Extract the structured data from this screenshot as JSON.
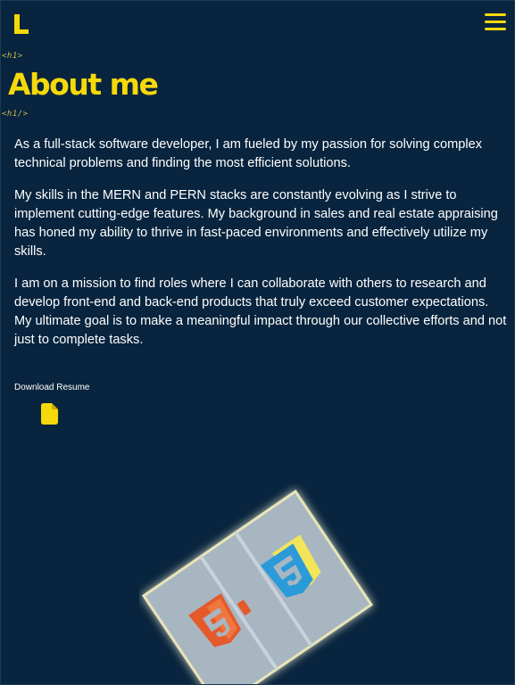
{
  "header": {
    "logo_letter": "L",
    "menu_icon": "hamburger-menu-icon"
  },
  "section": {
    "open_tag": "<h1>",
    "title": "About me",
    "close_tag": "<h1/>"
  },
  "bio": {
    "paragraphs": [
      "As a full-stack software developer, I am fueled by my passion for solving complex technical problems and finding the most efficient solutions.",
      "My skills in the MERN and PERN stacks are constantly evolving as I strive to implement cutting-edge features. My background in sales and real estate appraising has honed my ability to thrive in fast-paced environments and effectively utilize my skills.",
      "I am on a mission to find roles where I can collaborate with others to research and develop front-end and back-end products that truly exceed customer expectations. My ultimate goal is to make a meaningful impact through our collective efforts and not just to complete tasks."
    ]
  },
  "resume": {
    "label": "Download Resume",
    "icon": "file-icon"
  },
  "colors": {
    "background": "#08243e",
    "accent": "#f5d90a",
    "text": "#ffffff",
    "tag": "#c9b94e",
    "html5": "#e45a2b",
    "css3_blue": "#2b9ad8",
    "css3_yellow": "#f2e55a",
    "tile": "#aab8c4"
  },
  "decoration": {
    "icons": [
      "html5-icon",
      "css3-icon"
    ]
  }
}
